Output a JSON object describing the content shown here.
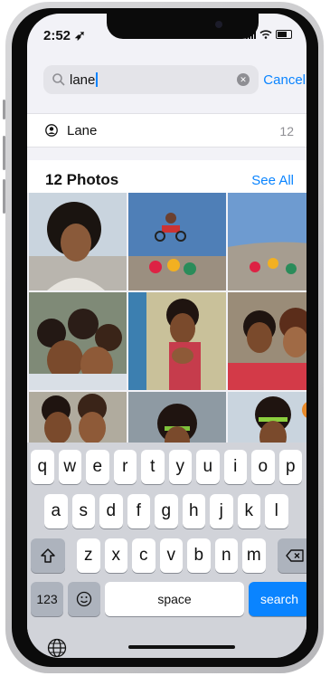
{
  "status": {
    "time": "2:52 ➶"
  },
  "search": {
    "query": "lane",
    "cancel_label": "Cancel"
  },
  "suggestion": {
    "label": "Lane",
    "count": "12"
  },
  "section": {
    "title": "12 Photos",
    "see_all": "See All"
  },
  "photos": [
    {
      "subject": "portrait-smiling-girl"
    },
    {
      "subject": "bmx-jump-sky"
    },
    {
      "subject": "skatepark-rider"
    },
    {
      "subject": "group-selfie"
    },
    {
      "subject": "girl-with-rings"
    },
    {
      "subject": "two-friends-selfie"
    },
    {
      "subject": "friends-close-up"
    },
    {
      "subject": "girl-with-headband"
    },
    {
      "subject": "girl-green-headband"
    }
  ],
  "keyboard": {
    "row1": [
      "q",
      "w",
      "e",
      "r",
      "t",
      "y",
      "u",
      "i",
      "o",
      "p"
    ],
    "row2": [
      "a",
      "s",
      "d",
      "f",
      "g",
      "h",
      "j",
      "k",
      "l"
    ],
    "row3": [
      "z",
      "x",
      "c",
      "v",
      "b",
      "n",
      "m"
    ],
    "numbers_label": "123",
    "space_label": "space",
    "search_label": "search"
  },
  "icons": {
    "search": "search-icon",
    "clear": "clear-icon",
    "person": "person-icon",
    "shift": "shift-icon",
    "backspace": "backspace-icon",
    "emoji": "emoji-icon",
    "globe": "globe-icon"
  },
  "colors": {
    "accent": "#0a84ff",
    "keyboard_bg": "#d1d3d9",
    "screen_bg": "#f2f2f7"
  }
}
